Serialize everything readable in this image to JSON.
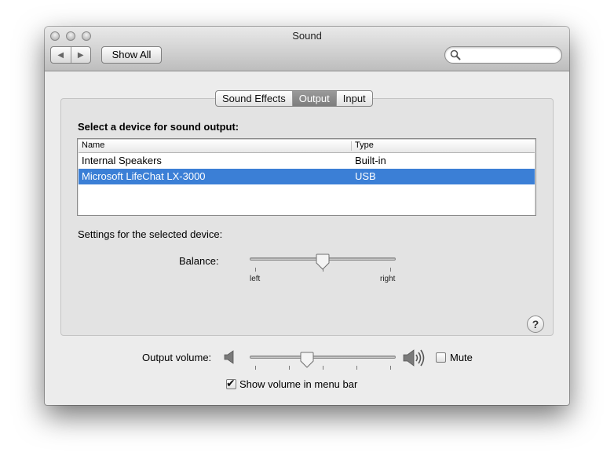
{
  "window": {
    "title": "Sound"
  },
  "toolbar": {
    "back_glyph": "◀",
    "forward_glyph": "▶",
    "show_all_label": "Show All",
    "search_placeholder": "",
    "search_value": ""
  },
  "tabs": [
    {
      "label": "Sound Effects",
      "active": false
    },
    {
      "label": "Output",
      "active": true
    },
    {
      "label": "Input",
      "active": false
    }
  ],
  "output": {
    "section_label": "Select a device for sound output:",
    "columns": {
      "name": "Name",
      "type": "Type"
    },
    "devices": [
      {
        "name": "Internal Speakers",
        "type": "Built-in",
        "selected": false
      },
      {
        "name": "Microsoft LifeChat LX-3000",
        "type": "USB",
        "selected": true
      }
    ],
    "settings_label": "Settings for the selected device:",
    "balance": {
      "label": "Balance:",
      "left_label": "left",
      "right_label": "right",
      "value": 0.5
    }
  },
  "help": {
    "glyph": "?"
  },
  "volume": {
    "label": "Output volume:",
    "level": 0.4,
    "mute_label": "Mute",
    "muted": false,
    "show_in_menu_bar_label": "Show volume in menu bar",
    "show_in_menu_bar": true,
    "check_glyph": "✔"
  },
  "icons": {
    "close": "close-button-icon",
    "minimize": "minimize-button-icon",
    "zoom": "zoom-button-icon",
    "search": "magnifier-icon",
    "speaker_low": "speaker-low-icon",
    "speaker_high": "speaker-high-icon",
    "help": "question-mark-icon"
  },
  "colors": {
    "selection": "#3b7fd6",
    "tab_active": "#8a8a8a"
  }
}
